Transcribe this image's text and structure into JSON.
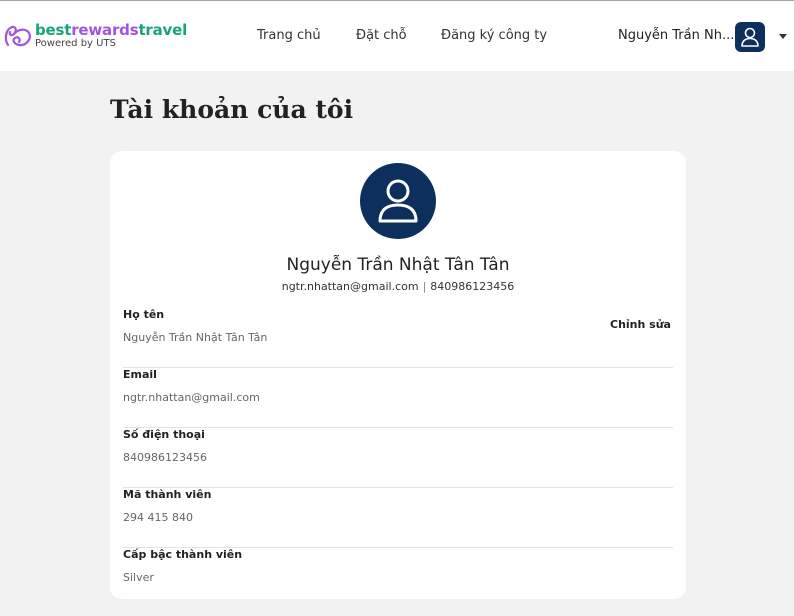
{
  "header": {
    "brand": {
      "part1": "best",
      "part2": "rewards",
      "part3": "travel",
      "powered_by": "Powered by UTS"
    },
    "nav": [
      {
        "label": "Trang chủ"
      },
      {
        "label": "Đặt chỗ"
      },
      {
        "label": "Đăng ký công ty"
      }
    ],
    "user_name": "Nguyễn Trần Nh...",
    "icons": {
      "avatar": "user-icon",
      "menu": "chevron-down-icon"
    }
  },
  "page": {
    "title": "Tài khoản của tôi"
  },
  "profile": {
    "name": "Nguyễn Trần Nhật Tân Tân",
    "email": "ngtr.nhattan@gmail.com",
    "separator": "|",
    "phone": "840986123456",
    "edit_label": "Chỉnh sửa",
    "fields": [
      {
        "label": "Họ tên",
        "value": "Nguyễn Trần Nhật Tân Tân"
      },
      {
        "label": "Email",
        "value": "ngtr.nhattan@gmail.com"
      },
      {
        "label": "Số điện thoại",
        "value": "840986123456"
      },
      {
        "label": "Mã thành viên",
        "value": "294 415 840"
      },
      {
        "label": "Cấp bậc thành viên",
        "value": "Silver"
      }
    ]
  },
  "colors": {
    "brand_green": "#1aa27d",
    "brand_purple": "#a254e0",
    "navy": "#0d2f5e",
    "background": "#f2f2f2"
  }
}
